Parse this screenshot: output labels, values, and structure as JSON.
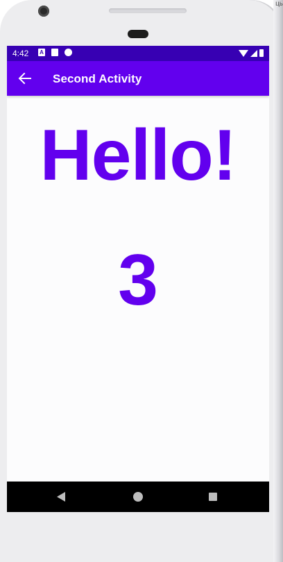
{
  "status_bar": {
    "time": "4:42",
    "notification_icons": [
      "a-icon",
      "sd-card-icon",
      "sync-icon"
    ],
    "system_icons": [
      "wifi-icon",
      "signal-icon",
      "battery-icon"
    ]
  },
  "app_bar": {
    "title": "Second Activity",
    "nav_icon": "arrow-back-icon"
  },
  "content": {
    "greeting": "Hello!",
    "count": "3"
  },
  "colors": {
    "primary": "#6200ee",
    "primary_dark": "#3700b3"
  }
}
